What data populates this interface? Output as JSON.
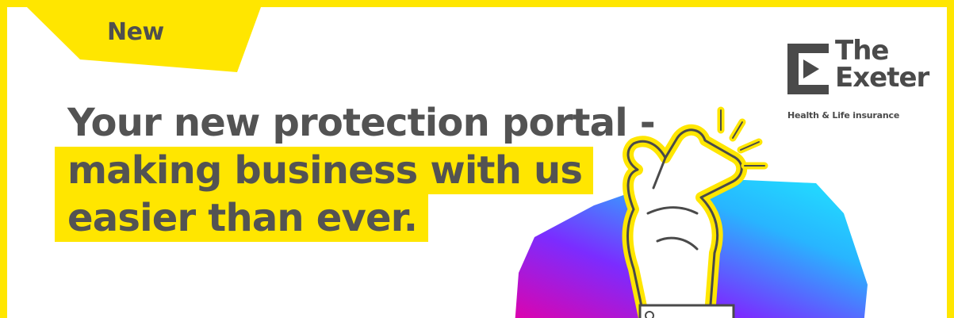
{
  "badge": {
    "label": "New"
  },
  "headline": {
    "line1": "Your new protection portal -",
    "line2": "making business with us",
    "line3": "easier than ever."
  },
  "logo": {
    "name_line1": "The",
    "name_line2": "Exeter",
    "tagline": "Health & Life insurance"
  },
  "colors": {
    "accent_yellow": "#ffe600",
    "text_gray": "#535353",
    "gradient": [
      "#e300a8",
      "#7b2cff",
      "#28b5ff",
      "#20e7ff"
    ]
  },
  "icons": [
    "finger-snap-hand-icon",
    "the-exeter-logo-mark"
  ]
}
